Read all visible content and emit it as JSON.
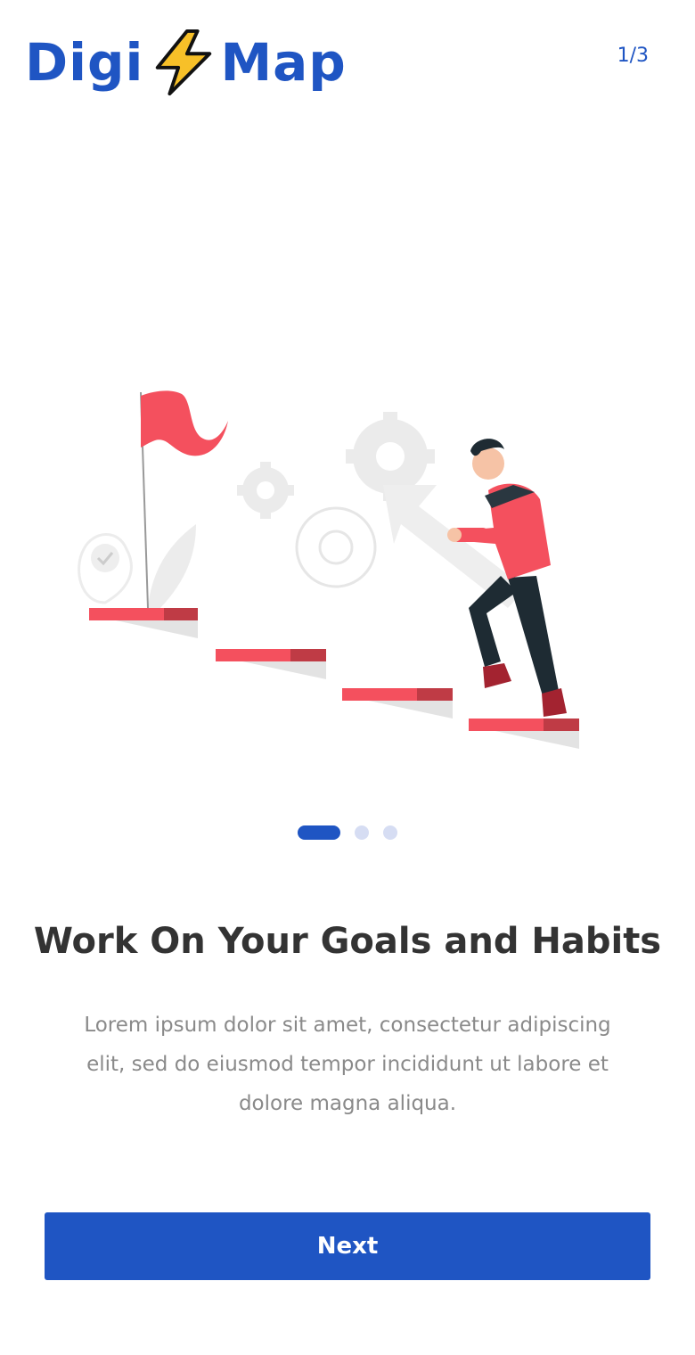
{
  "header": {
    "logo_left": "Digi",
    "logo_right": "Map",
    "logo_icon": "lightning-bolt-icon",
    "page_indicator": "1/3"
  },
  "illustration": {
    "description_icon": "staircase-goal-illustration"
  },
  "pagination": {
    "total": 3,
    "active": 1
  },
  "content": {
    "title": "Work On Your Goals and Habits",
    "body": "Lorem ipsum dolor sit amet, consectetur adipiscing elit, sed do eiusmod tempor incididunt ut labore et dolore magna aliqua."
  },
  "actions": {
    "next_label": "Next"
  },
  "colors": {
    "brand": "#1f55c3",
    "accent_red": "#f4505e",
    "bolt_yellow": "#f7c028",
    "title_text": "#333333",
    "body_text": "#8a8a8a"
  }
}
